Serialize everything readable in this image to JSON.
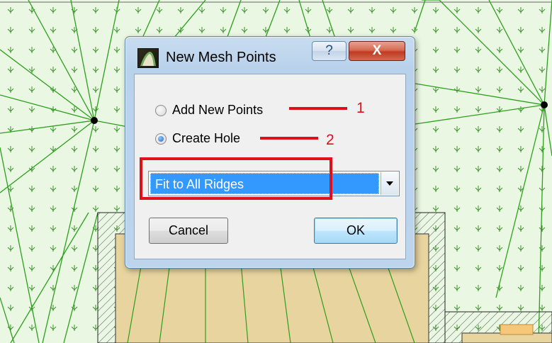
{
  "dialog": {
    "title": "New Mesh Points",
    "help_glyph": "?",
    "close_glyph": "X",
    "options": [
      {
        "label": "Add New Points",
        "checked": false
      },
      {
        "label": "Create Hole",
        "checked": true
      }
    ],
    "mode_select": {
      "value": "Fit to All Ridges"
    },
    "buttons": {
      "cancel": "Cancel",
      "ok": "OK"
    }
  },
  "annotations": {
    "numbers": [
      "1",
      "2"
    ],
    "color": "#e0101a"
  },
  "colors": {
    "mesh_fill": "#eaf8e3",
    "mesh_lines": "#2e9e1e",
    "slab_fill": "#e8d49e",
    "selection": "#3399ff"
  },
  "icons": {
    "app": "archicad-mesh-icon",
    "help": "question-icon",
    "close": "close-icon",
    "dropdown": "chevron-down-icon",
    "grass": "grass-symbol"
  }
}
